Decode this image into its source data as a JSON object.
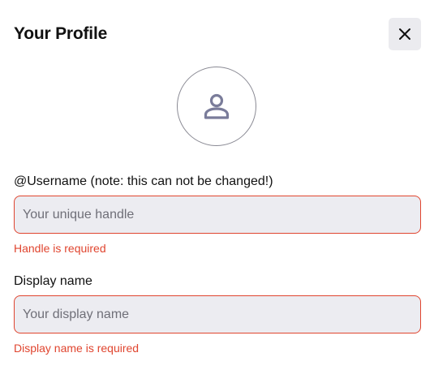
{
  "header": {
    "title": "Your Profile",
    "close_icon": "close-icon"
  },
  "avatar": {
    "icon": "person-icon"
  },
  "form": {
    "username": {
      "label": "@Username (note: this can not be changed!)",
      "placeholder": "Your unique handle",
      "value": "",
      "error": "Handle is required"
    },
    "display_name": {
      "label": "Display name",
      "placeholder": "Your display name",
      "value": "",
      "error": "Display name is required"
    }
  },
  "colors": {
    "error": "#e0452f",
    "input_background": "#ececf1",
    "avatar_icon": "#7a7c9a"
  }
}
